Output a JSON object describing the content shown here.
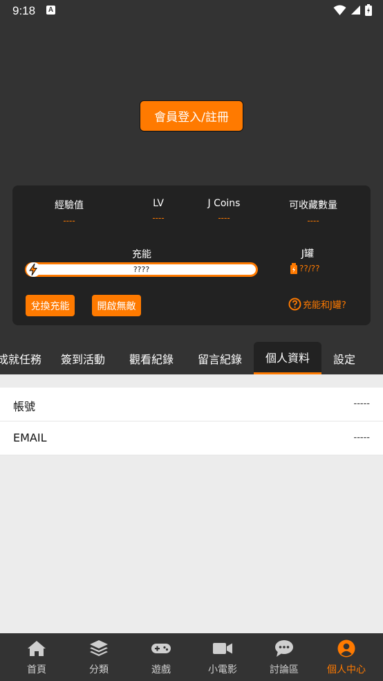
{
  "status": {
    "time": "9:18",
    "a_badge": "A"
  },
  "login_button": "會員登入/註冊",
  "stats": [
    {
      "label": "經驗值",
      "value": "----"
    },
    {
      "label": "LV",
      "value": "----"
    },
    {
      "label": "J Coins",
      "value": "----"
    },
    {
      "label": "可收藏數量",
      "value": "----"
    }
  ],
  "charge": {
    "label": "充能",
    "value": "????",
    "fill": 0
  },
  "jcan": {
    "label": "J罐",
    "value": "??/??"
  },
  "buttons": {
    "redeem": "兌換充能",
    "invincible": "開啟無敵",
    "help": "充能和J罐?"
  },
  "tabs": [
    {
      "label": "成就任務",
      "active": false
    },
    {
      "label": "簽到活動",
      "active": false
    },
    {
      "label": "觀看紀錄",
      "active": false
    },
    {
      "label": "留言紀錄",
      "active": false
    },
    {
      "label": "個人資料",
      "active": true
    },
    {
      "label": "設定",
      "active": false
    }
  ],
  "profile": [
    {
      "key": "帳號",
      "value": "-----"
    },
    {
      "key": "EMAIL",
      "value": "-----"
    }
  ],
  "nav": [
    {
      "label": "首頁",
      "icon": "home-icon",
      "active": false
    },
    {
      "label": "分類",
      "icon": "layers-icon",
      "active": false
    },
    {
      "label": "遊戲",
      "icon": "gamepad-icon",
      "active": false
    },
    {
      "label": "小電影",
      "icon": "video-camera-icon",
      "active": false
    },
    {
      "label": "討論區",
      "icon": "chat-bubble-icon",
      "active": false
    },
    {
      "label": "個人中心",
      "icon": "user-circle-icon",
      "active": true
    }
  ],
  "colors": {
    "accent": "#ff7a00",
    "dark_bg": "#333333",
    "card_bg": "#222222"
  }
}
